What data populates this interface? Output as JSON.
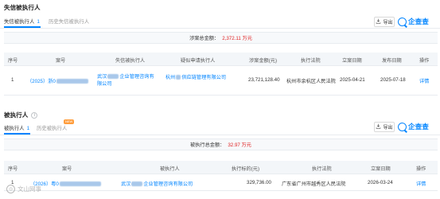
{
  "section1": {
    "title": "失信被执行人",
    "tabs": [
      {
        "label": "失信被执行人",
        "count": "1"
      },
      {
        "label": "历史失信被执行人",
        "count": ""
      }
    ],
    "export_label": "导出",
    "logo_text": "企查查",
    "summary_label": "涉案总金额：",
    "summary_value": "2,372.11 万元",
    "columns": [
      "序号",
      "案号",
      "失信被执行人",
      "疑似申请执行人",
      "涉案金额(元)",
      "执行法院",
      "立案日期",
      "发布日期",
      "操作"
    ],
    "row": {
      "index": "1",
      "case_prefix": "（2025）浙0",
      "executed_party_line1": "武汉",
      "executed_party_line1_suffix": "企业管理咨询有",
      "executed_party_line2": "限公司",
      "applicant_prefix": "杭州",
      "applicant_suffix": "供应链管理有限公司",
      "amount": "23,721,128.40",
      "court": "杭州市余杭区人民法院",
      "filing_date": "2025-04-21",
      "publish_date": "2025-07-18",
      "action": "详情"
    }
  },
  "section2": {
    "title": "被执行人",
    "tabs": [
      {
        "label": "被执行人",
        "count": "1"
      },
      {
        "label": "历史被执行人",
        "count": ""
      }
    ],
    "badge": "NEW",
    "export_label": "导出",
    "logo_text": "企查查",
    "summary_label": "被执行总金额：",
    "summary_value": "32.97 万元",
    "columns": [
      "序号",
      "案号",
      "被执行人",
      "执行标的(元)",
      "执行法院",
      "立案日期",
      "操作"
    ],
    "row": {
      "index": "1",
      "case_prefix": "（2026）粤0",
      "executed_party_prefix": "武汉",
      "executed_party_suffix": "企业管理咨询有限公司",
      "amount": "329,736.00",
      "court": "广东省广州市越秀区人民法院",
      "filing_date": "2026-03-24",
      "action": "详情"
    }
  },
  "watermark_text": "文山网事"
}
